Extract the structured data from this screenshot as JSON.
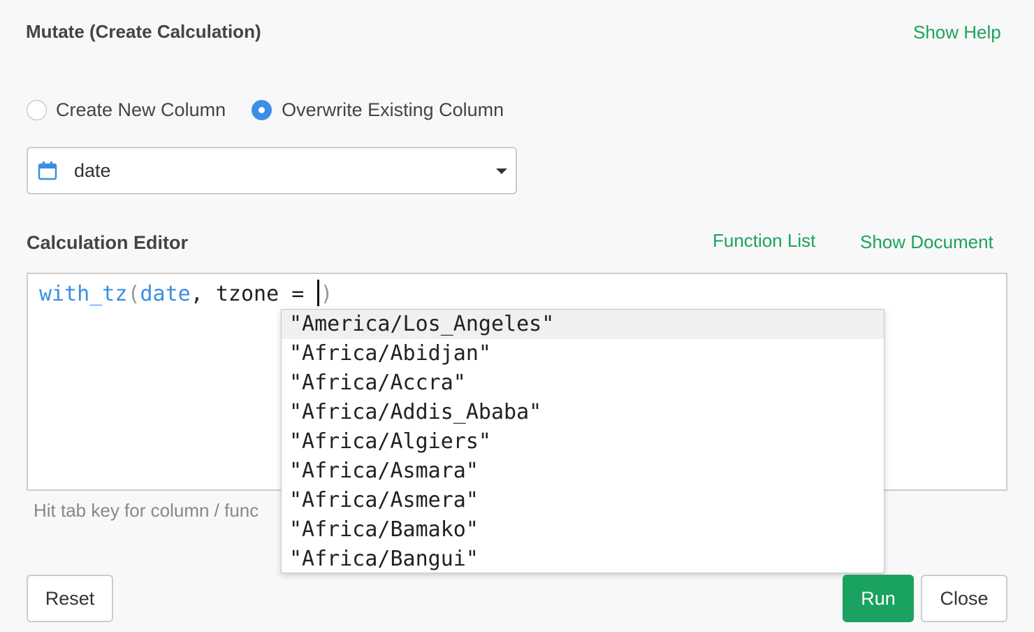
{
  "dialog": {
    "title": "Mutate (Create Calculation)",
    "show_help": "Show Help"
  },
  "mode": {
    "options": [
      {
        "label": "Create New Column",
        "checked": false
      },
      {
        "label": "Overwrite Existing Column",
        "checked": true
      }
    ]
  },
  "column_select": {
    "icon": "calendar-icon",
    "value": "date"
  },
  "editor": {
    "section_title": "Calculation Editor",
    "function_list": "Function List",
    "show_document": "Show Document",
    "code": {
      "fn": "with_tz",
      "open": "(",
      "arg": "date",
      "rest": ", tzone = ",
      "close": ")"
    },
    "hint": "Hit tab key for column / func"
  },
  "autocomplete": {
    "items": [
      "\"America/Los_Angeles\"",
      "\"Africa/Abidjan\"",
      "\"Africa/Accra\"",
      "\"Africa/Addis_Ababa\"",
      "\"Africa/Algiers\"",
      "\"Africa/Asmara\"",
      "\"Africa/Asmera\"",
      "\"Africa/Bamako\"",
      "\"Africa/Bangui\""
    ],
    "selected_index": 0
  },
  "footer": {
    "reset": "Reset",
    "run": "Run",
    "close": "Close"
  },
  "colors": {
    "accent_green": "#1aa260",
    "radio_blue": "#3d8fe6",
    "code_blue": "#3a8fe0"
  }
}
